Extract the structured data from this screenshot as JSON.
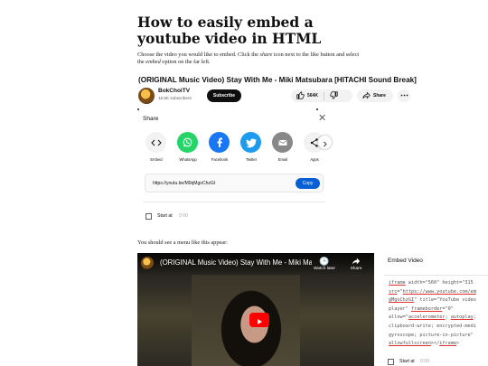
{
  "article": {
    "title": "How to easily embed a youtube video in HTML",
    "intro": {
      "p1": "Choose the video you would like to embed. Click the ",
      "share_word": "share",
      "p2": " icon next to the like button and select the ",
      "embed_word": "embed",
      "p3": " option on the far left."
    },
    "second_caption": "You should see a menu like this appear:"
  },
  "video": {
    "title": "(ORIGINAL Music Video) Stay With Me - Miki Matsubara [HITACHI Sound Break]",
    "channel": "BokChoiTV",
    "subscribers": "18.5K subscribers",
    "subscribe_label": "Subscribe",
    "likes": "564K",
    "share_label": "Share"
  },
  "share_panel": {
    "heading": "Share",
    "targets": [
      {
        "label": "Embed",
        "icon": "embed-code-icon",
        "color": "#f2f2f2"
      },
      {
        "label": "WhatsApp",
        "icon": "whatsapp-icon",
        "color": "#25d366"
      },
      {
        "label": "Facebook",
        "icon": "facebook-icon",
        "color": "#1877f2"
      },
      {
        "label": "Twitter",
        "icon": "twitter-icon",
        "color": "#1d9bf0"
      },
      {
        "label": "Email",
        "icon": "email-icon",
        "color": "#888888"
      },
      {
        "label": "Apps",
        "icon": "share-apps-icon",
        "color": "#f2f2f2"
      }
    ],
    "url": "https://youtu.be/M0qMgoChzGI",
    "copy_label": "Copy",
    "start_label": "Start at",
    "start_time": "0:00"
  },
  "player": {
    "title": "(ORIGINAL Music Video) Stay With Me - Miki Mat...",
    "watch_later": "Watch later",
    "share": "Share"
  },
  "embed_panel": {
    "heading": "Embed Video",
    "code_lines": [
      {
        "parts": [
          {
            "u": "iframe"
          },
          {
            "t": " width=\"560\" height=\"315"
          }
        ]
      },
      {
        "parts": [
          {
            "u": "src"
          },
          {
            "t": "=\""
          },
          {
            "u": "https://www.youtube.com/em"
          }
        ]
      },
      {
        "parts": [
          {
            "u": "gMgoChzGI"
          },
          {
            "t": "\" title=\"YouTube video"
          }
        ]
      },
      {
        "parts": [
          {
            "t": "player\" "
          },
          {
            "u": "frameborder"
          },
          {
            "t": "=\"0\""
          }
        ]
      },
      {
        "parts": [
          {
            "t": "allow=\""
          },
          {
            "u": "accelerometer"
          },
          {
            "t": "; "
          },
          {
            "u": "autoplay"
          },
          {
            "t": ";"
          }
        ]
      },
      {
        "parts": [
          {
            "t": "clipboard-write; encrypted-medi"
          }
        ]
      },
      {
        "parts": [
          {
            "t": "gyroscope; picture-in-picture\""
          }
        ]
      },
      {
        "parts": [
          {
            "u": "allowfullscreen"
          },
          {
            "t": "></"
          },
          {
            "u": "iframe"
          },
          {
            "t": ">"
          }
        ]
      }
    ],
    "start_label": "Start at",
    "start_time": "0:00"
  },
  "colors": {
    "youtube_red": "#ff0000",
    "copy_blue": "#065fd4",
    "code_underline": "#e03030"
  }
}
